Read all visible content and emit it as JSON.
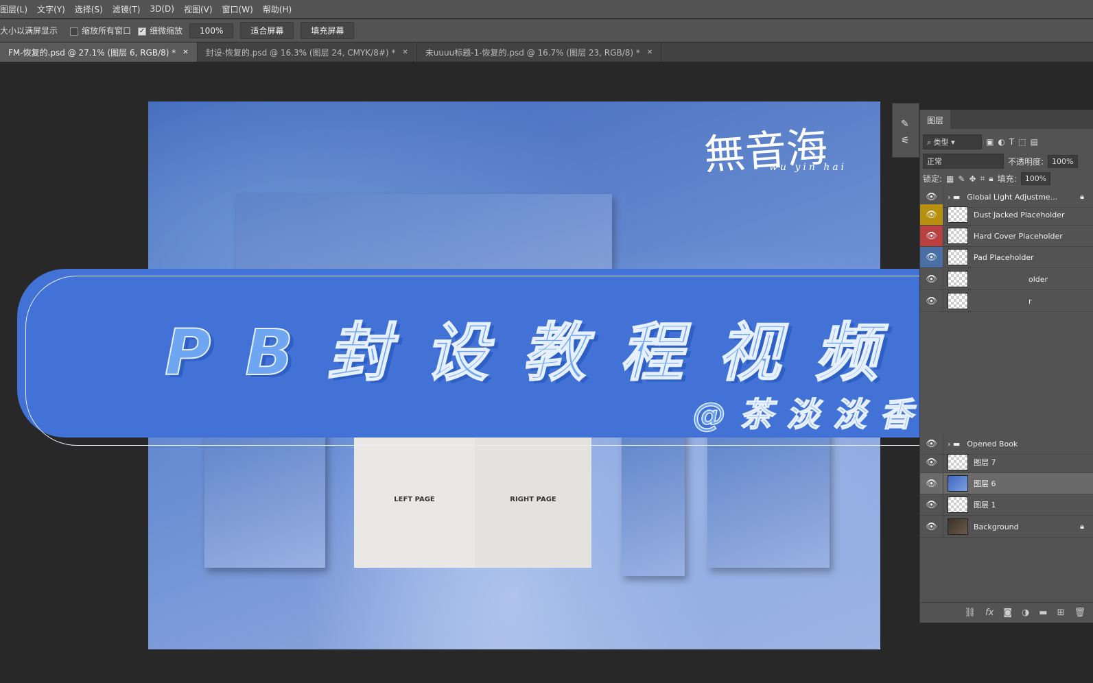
{
  "menu": [
    "图层(L)",
    "文字(Y)",
    "选择(S)",
    "滤镜(T)",
    "3D(D)",
    "视图(V)",
    "窗口(W)",
    "帮助(H)"
  ],
  "options": {
    "fit_label": "大小以满屏显示",
    "zoom_all": "缩放所有窗口",
    "scrubby": "细微缩放",
    "zoom_value": "100%",
    "fit_screen": "适合屏幕",
    "fill_screen": "填充屏幕"
  },
  "tabs": [
    {
      "label": "FM-恢复的.psd @ 27.1% (图层 6, RGB/8) *"
    },
    {
      "label": "封设-恢复的.psd @ 16.3% (图层 24, CMYK/8#) *"
    },
    {
      "label": "未uuuu标题-1-恢复的.psd @ 16.7% (图层 23, RGB/8) *"
    }
  ],
  "canvas": {
    "cal_main": "無音海",
    "cal_sub": "wu yin hai",
    "left_page": "LEFT PAGE",
    "right_page": "RIGHT PAGE"
  },
  "banner": {
    "title": "PB封设教程视频",
    "subtitle": "@茶淡淡香",
    "color": "#4272d6"
  },
  "layers_panel": {
    "tab": "图层",
    "filter": "类型",
    "blend": "正常",
    "opacity_label": "不透明度:",
    "opacity": "100%",
    "lock_label": "锁定:",
    "fill_label": "填充:",
    "fill": "100%",
    "layers": [
      {
        "name": "Global Light Adjustme...",
        "type": "group",
        "locked": true,
        "color": ""
      },
      {
        "name": "Dust Jacked Placeholder",
        "type": "smart",
        "color": "#b8900f"
      },
      {
        "name": "Hard Cover Placeholder",
        "type": "smart",
        "color": "#b84040"
      },
      {
        "name": "Pad Placeholder",
        "type": "smart",
        "color": "#4a6fa5"
      },
      {
        "name": "older",
        "type": "smart",
        "color": ""
      },
      {
        "name": "r",
        "type": "smart",
        "color": ""
      },
      {
        "name": "Opened Book",
        "type": "group",
        "color": ""
      },
      {
        "name": "图层 7",
        "type": "layer",
        "color": ""
      },
      {
        "name": "图层 6",
        "type": "layer",
        "selected": true,
        "color": ""
      },
      {
        "name": "图层 1",
        "type": "layer",
        "color": ""
      },
      {
        "name": "Background",
        "type": "layer",
        "locked": true,
        "color": ""
      }
    ]
  }
}
